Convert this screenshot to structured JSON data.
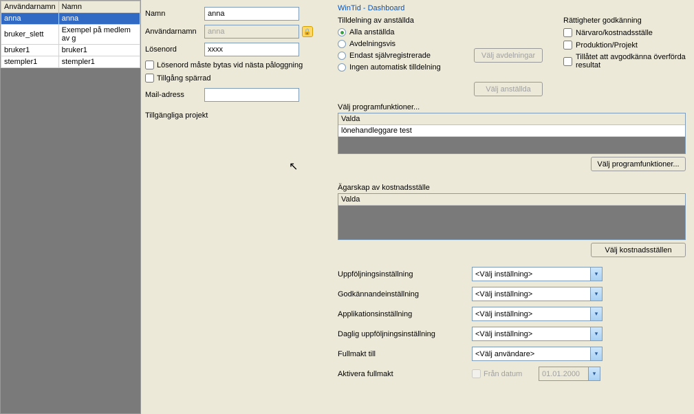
{
  "userTable": {
    "headers": [
      "Användarnamn",
      "Namn"
    ],
    "rows": [
      {
        "user": "anna",
        "name": "anna",
        "selected": true
      },
      {
        "user": "bruker_slett",
        "name": "Exempel på medlem av g",
        "selected": false
      },
      {
        "user": "bruker1",
        "name": "bruker1",
        "selected": false
      },
      {
        "user": "stempler1",
        "name": "stempler1",
        "selected": false
      }
    ]
  },
  "form": {
    "nameLabel": "Namn",
    "nameValue": "anna",
    "usernameLabel": "Användarnamn",
    "usernameValue": "anna",
    "passwordLabel": "Lösenord",
    "passwordValue": "xxxx",
    "mustChangePwd": "Lösenord måste bytas vid nästa påloggning",
    "accessBlocked": "Tillgång spärrad",
    "mailLabel": "Mail-adress",
    "mailValue": "",
    "projectsLabel": "Tillgängliga projekt"
  },
  "right": {
    "appTitle": "WinTid - Dashboard",
    "assignTitle": "Tilldelning av anställda",
    "rightsTitle": "Rättigheter godkänning",
    "radios": {
      "all": "Alla anställda",
      "dept": "Avdelningsvis",
      "selfreg": "Endast självregistrerade",
      "noneauto": "Ingen automatisk tilldelning"
    },
    "btnSelectDept": "Välj avdelningar",
    "btnSelectEmp": "Välj anställda",
    "checks": {
      "attendance": "Närvaro/kostnadsställe",
      "production": "Produktion/Projekt",
      "approve": "Tillåtet att avgodkänna överförda resultat"
    },
    "progFuncLabel": "Välj programfunktioner...",
    "listHeader": "Valda",
    "progFuncItem": "lönehandleggare test",
    "btnProgFunc": "Välj programfunktioner...",
    "ownershipLabel": "Ägarskap av kostnadsställe",
    "btnCostCenter": "Välj kostnadsställen",
    "dropdowns": {
      "followup": {
        "label": "Uppföljningsinställning",
        "value": "<Välj inställning>"
      },
      "approval": {
        "label": "Godkännandeinställning",
        "value": "<Välj inställning>"
      },
      "app": {
        "label": "Applikationsinställning",
        "value": "<Välj inställning>"
      },
      "daily": {
        "label": "Daglig uppföljningsinställning",
        "value": "<Välj inställning>"
      },
      "proxy": {
        "label": "Fullmakt till",
        "value": "<Välj användare>"
      }
    },
    "activateProxy": "Aktivera fullmakt",
    "fromDate": "Från datum",
    "dateValue": "01.01.2000"
  }
}
